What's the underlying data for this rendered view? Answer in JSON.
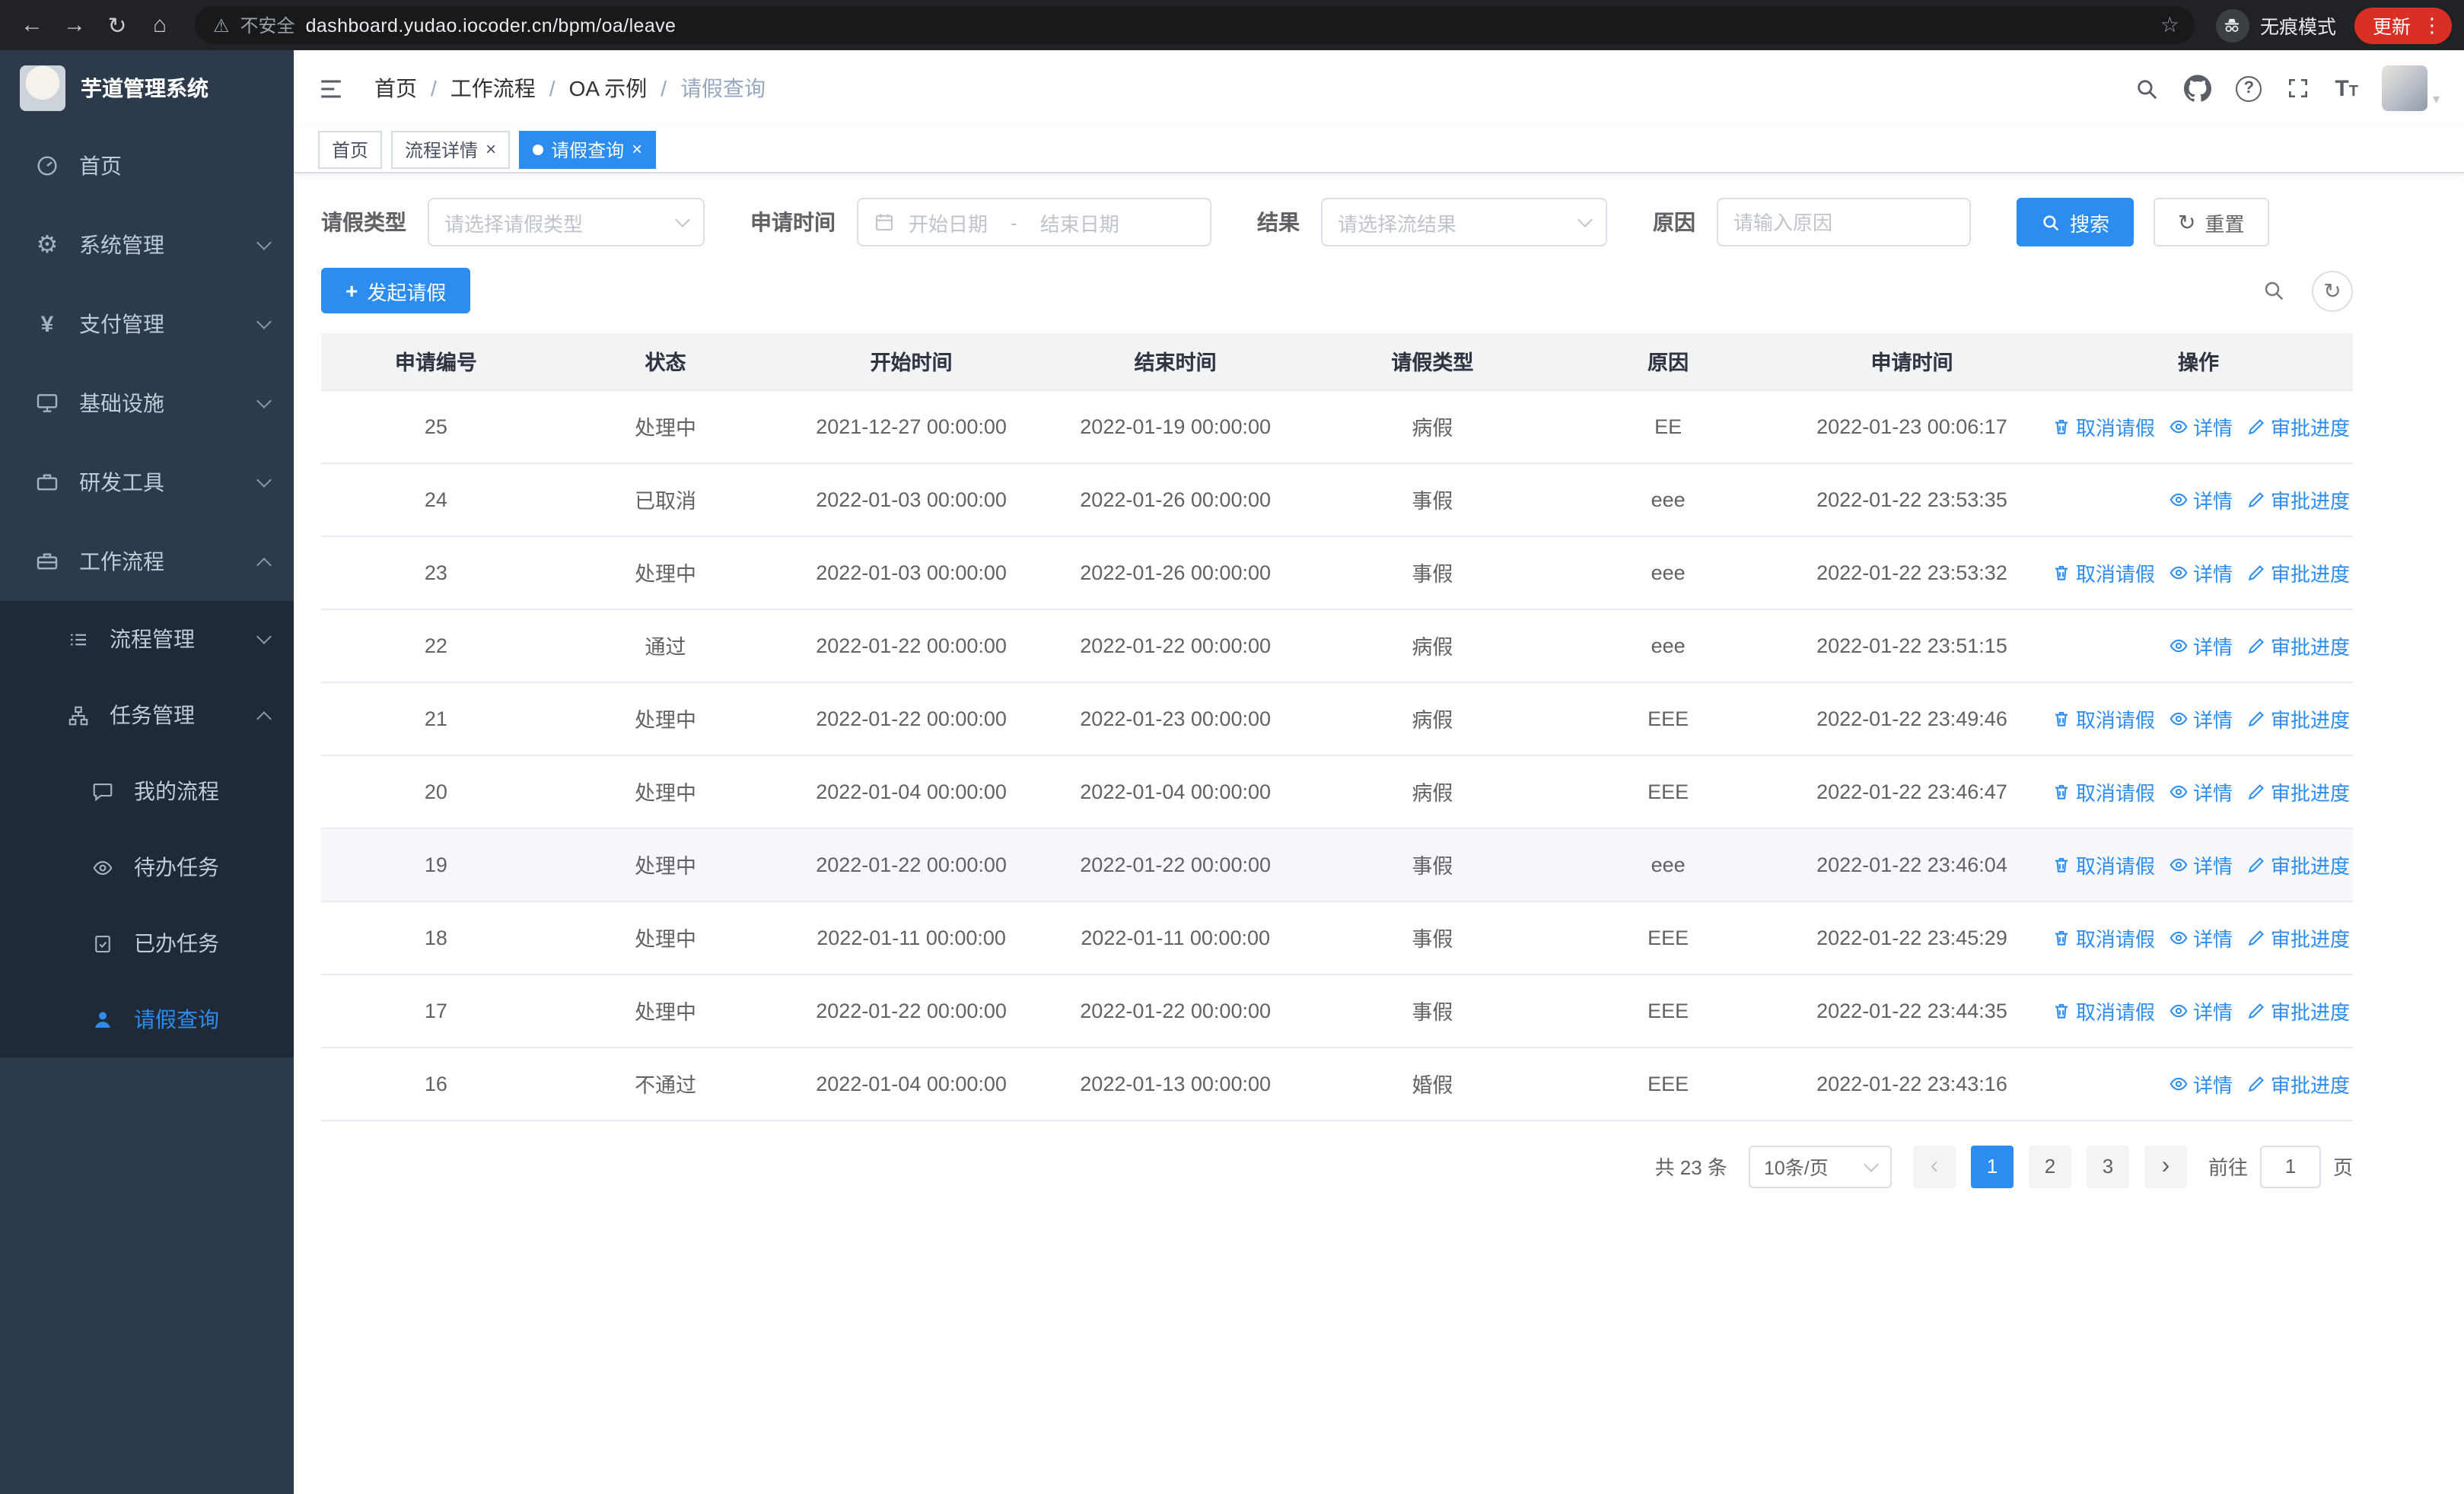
{
  "colors": {
    "accent": "#2d8cf0",
    "sidebar_bg": "#2d3a4b",
    "sidebar_submenu_bg": "#1f2a38",
    "update_badge": "#d93025",
    "table_header_bg": "#f2f3f5"
  },
  "icons": {
    "back": "←",
    "forward": "→",
    "reload": "↻",
    "home": "⌂",
    "warning": "⚠",
    "star": "☆",
    "menu_dots": "⋮",
    "help": "?",
    "breadcrumb_separator": "/",
    "tab_close": "×",
    "gear": "⚙",
    "yen": "¥",
    "refresh": "↻",
    "plus": "+",
    "prev": "‹",
    "next": "›",
    "caret": "▾",
    "text_large": "T",
    "text_small": "T"
  },
  "browser": {
    "security_warning": "不安全",
    "url": "dashboard.yudao.iocoder.cn/bpm/oa/leave",
    "incognito_label": "无痕模式",
    "update_label": "更新"
  },
  "sidebar": {
    "logo_title": "芋道管理系统",
    "items": [
      {
        "label": "首页"
      },
      {
        "label": "系统管理"
      },
      {
        "label": "支付管理"
      },
      {
        "label": "基础设施"
      },
      {
        "label": "研发工具"
      },
      {
        "label": "工作流程"
      }
    ],
    "workflow_children": [
      {
        "label": "流程管理"
      },
      {
        "label": "任务管理"
      }
    ],
    "task_children": [
      {
        "label": "我的流程"
      },
      {
        "label": "待办任务"
      },
      {
        "label": "已办任务"
      },
      {
        "label": "请假查询",
        "active": true
      }
    ]
  },
  "header": {
    "breadcrumb": [
      "首页",
      "工作流程",
      "OA 示例",
      "请假查询"
    ]
  },
  "tabs": [
    {
      "label": "首页",
      "active": false,
      "closable": false
    },
    {
      "label": "流程详情",
      "active": false,
      "closable": true
    },
    {
      "label": "请假查询",
      "active": true,
      "closable": true
    }
  ],
  "filters": {
    "leave_type_label": "请假类型",
    "leave_type_placeholder": "请选择请假类型",
    "apply_time_label": "申请时间",
    "start_date_placeholder": "开始日期",
    "range_separator": "-",
    "end_date_placeholder": "结束日期",
    "result_label": "结果",
    "result_placeholder": "请选择流结果",
    "reason_label": "原因",
    "reason_placeholder": "请输入原因",
    "search_label": "搜索",
    "reset_label": "重置"
  },
  "toolbar": {
    "create_label": "发起请假"
  },
  "table": {
    "columns": [
      "申请编号",
      "状态",
      "开始时间",
      "结束时间",
      "请假类型",
      "原因",
      "申请时间",
      "操作"
    ],
    "action_labels": {
      "cancel": "取消请假",
      "detail": "详情",
      "progress": "审批进度"
    },
    "rows": [
      {
        "id": "25",
        "status": "处理中",
        "start": "2021-12-27 00:00:00",
        "end": "2022-01-19 00:00:00",
        "type": "病假",
        "reason": "EE",
        "applied": "2022-01-23 00:06:17",
        "actions": [
          "cancel",
          "detail",
          "progress"
        ]
      },
      {
        "id": "24",
        "status": "已取消",
        "start": "2022-01-03 00:00:00",
        "end": "2022-01-26 00:00:00",
        "type": "事假",
        "reason": "eee",
        "applied": "2022-01-22 23:53:35",
        "actions": [
          "detail",
          "progress"
        ]
      },
      {
        "id": "23",
        "status": "处理中",
        "start": "2022-01-03 00:00:00",
        "end": "2022-01-26 00:00:00",
        "type": "事假",
        "reason": "eee",
        "applied": "2022-01-22 23:53:32",
        "actions": [
          "cancel",
          "detail",
          "progress"
        ]
      },
      {
        "id": "22",
        "status": "通过",
        "start": "2022-01-22 00:00:00",
        "end": "2022-01-22 00:00:00",
        "type": "病假",
        "reason": "eee",
        "applied": "2022-01-22 23:51:15",
        "actions": [
          "detail",
          "progress"
        ]
      },
      {
        "id": "21",
        "status": "处理中",
        "start": "2022-01-22 00:00:00",
        "end": "2022-01-23 00:00:00",
        "type": "病假",
        "reason": "EEE",
        "applied": "2022-01-22 23:49:46",
        "actions": [
          "cancel",
          "detail",
          "progress"
        ]
      },
      {
        "id": "20",
        "status": "处理中",
        "start": "2022-01-04 00:00:00",
        "end": "2022-01-04 00:00:00",
        "type": "病假",
        "reason": "EEE",
        "applied": "2022-01-22 23:46:47",
        "actions": [
          "cancel",
          "detail",
          "progress"
        ]
      },
      {
        "id": "19",
        "status": "处理中",
        "start": "2022-01-22 00:00:00",
        "end": "2022-01-22 00:00:00",
        "type": "事假",
        "reason": "eee",
        "applied": "2022-01-22 23:46:04",
        "actions": [
          "cancel",
          "detail",
          "progress"
        ],
        "hovered": true
      },
      {
        "id": "18",
        "status": "处理中",
        "start": "2022-01-11 00:00:00",
        "end": "2022-01-11 00:00:00",
        "type": "事假",
        "reason": "EEE",
        "applied": "2022-01-22 23:45:29",
        "actions": [
          "cancel",
          "detail",
          "progress"
        ]
      },
      {
        "id": "17",
        "status": "处理中",
        "start": "2022-01-22 00:00:00",
        "end": "2022-01-22 00:00:00",
        "type": "事假",
        "reason": "EEE",
        "applied": "2022-01-22 23:44:35",
        "actions": [
          "cancel",
          "detail",
          "progress"
        ]
      },
      {
        "id": "16",
        "status": "不通过",
        "start": "2022-01-04 00:00:00",
        "end": "2022-01-13 00:00:00",
        "type": "婚假",
        "reason": "EEE",
        "applied": "2022-01-22 23:43:16",
        "actions": [
          "detail",
          "progress"
        ]
      }
    ]
  },
  "pagination": {
    "total_text": "共 23 条",
    "page_size_label": "10条/页",
    "pages": [
      "1",
      "2",
      "3"
    ],
    "active_page": "1",
    "goto_label": "前往",
    "goto_value": "1",
    "goto_unit": "页"
  }
}
